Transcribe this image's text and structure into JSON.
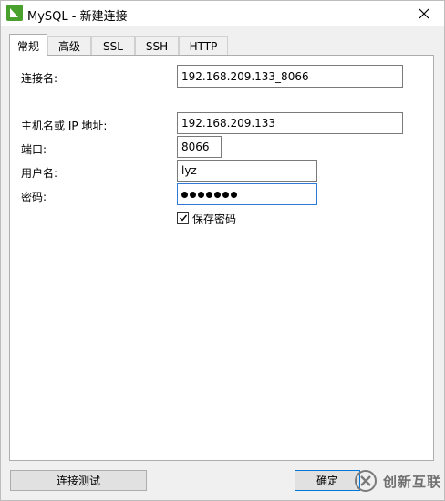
{
  "window": {
    "title": "MySQL - 新建连接"
  },
  "tabs": [
    {
      "label": "常规",
      "active": true
    },
    {
      "label": "高级"
    },
    {
      "label": "SSL"
    },
    {
      "label": "SSH"
    },
    {
      "label": "HTTP"
    }
  ],
  "form": {
    "connection_name": {
      "label": "连接名:",
      "value": "192.168.209.133_8066"
    },
    "host": {
      "label": "主机名或 IP 地址:",
      "value": "192.168.209.133"
    },
    "port": {
      "label": "端口:",
      "value": "8066"
    },
    "username": {
      "label": "用户名:",
      "value": "lyz"
    },
    "password": {
      "label": "密码:",
      "masked_length": 7
    },
    "save_password": {
      "label": "保存密码",
      "checked": true
    }
  },
  "buttons": {
    "test": "连接测试",
    "ok": "确定"
  },
  "watermark": {
    "text": "创新互联"
  },
  "colors": {
    "focus_border": "#2f7ad6",
    "app_icon_green": "#4aa02c",
    "primary_border": "#0078d7"
  },
  "icons": {
    "app": "navicat-leaf-icon",
    "close": "close-icon",
    "check": "check-icon",
    "watermark": "chuangxin-logo-icon"
  }
}
